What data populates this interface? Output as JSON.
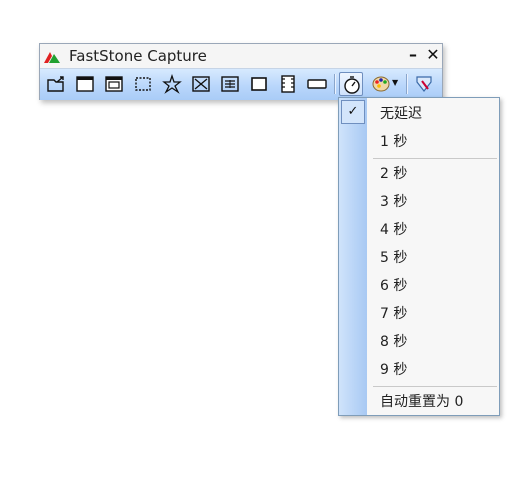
{
  "window": {
    "title": "FastStone Capture"
  },
  "menu": {
    "items": [
      "无延迟",
      "1 秒",
      "2 秒",
      "3 秒",
      "4 秒",
      "5 秒",
      "6 秒",
      "7 秒",
      "8 秒",
      "9 秒",
      "自动重置为 0"
    ],
    "checked_item": "无延迟"
  },
  "colors": {
    "toolbar_top": "#d7eafe",
    "toolbar_bottom": "#a9ccf7",
    "menu_border": "#7f9db9"
  }
}
